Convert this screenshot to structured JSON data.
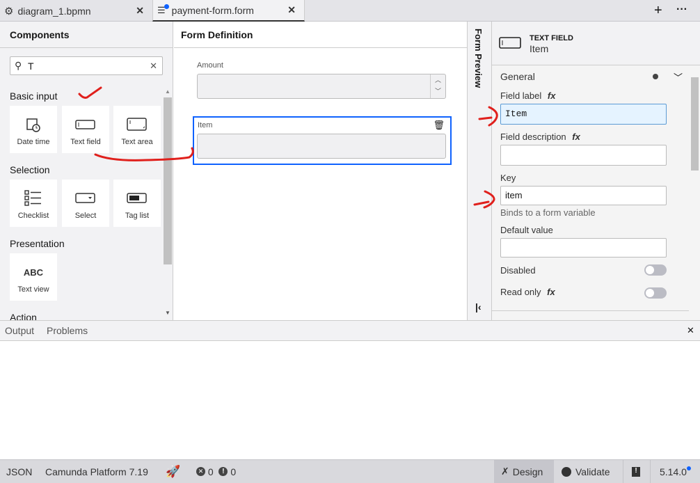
{
  "tabs": [
    {
      "label": "diagram_1.bpmn",
      "icon": "gear-icon"
    },
    {
      "label": "payment-form.form",
      "icon": "form-icon",
      "unsaved": true,
      "active": true
    }
  ],
  "tabbar_actions": {
    "add": "+",
    "more": "···"
  },
  "components": {
    "title": "Components",
    "search_value": "T",
    "sections": [
      {
        "title": "Basic input",
        "items": [
          "Date time",
          "Text field",
          "Text area"
        ]
      },
      {
        "title": "Selection",
        "items": [
          "Checklist",
          "Select",
          "Tag list"
        ]
      },
      {
        "title": "Presentation",
        "items": [
          "Text view"
        ],
        "text_view_icon": "ABC"
      },
      {
        "title": "Action",
        "items": []
      }
    ]
  },
  "form_definition": {
    "title": "Form Definition",
    "fields": [
      {
        "label": "Amount",
        "type": "number"
      },
      {
        "label": "Item",
        "type": "textfield",
        "selected": true
      }
    ]
  },
  "form_preview": {
    "label": "Form Preview"
  },
  "properties": {
    "type": "TEXT FIELD",
    "name": "Item",
    "group": "General",
    "field_label": {
      "label": "Field label",
      "fx": "fx",
      "value": "Item"
    },
    "field_description": {
      "label": "Field description",
      "fx": "fx",
      "value": ""
    },
    "key": {
      "label": "Key",
      "value": "item",
      "hint": "Binds to a form variable"
    },
    "default_value": {
      "label": "Default value",
      "value": ""
    },
    "disabled": {
      "label": "Disabled",
      "on": false
    },
    "read_only": {
      "label": "Read only",
      "fx": "fx",
      "on": false
    }
  },
  "bottom_panel": {
    "tabs": [
      "Output",
      "Problems"
    ]
  },
  "status": {
    "format": "JSON",
    "platform": "Camunda Platform 7.19",
    "errors": "0",
    "warnings": "0",
    "design": "Design",
    "validate": "Validate",
    "version": "5.14.0"
  },
  "colors": {
    "accent": "#0f62fe",
    "annotation": "#e0201c"
  }
}
